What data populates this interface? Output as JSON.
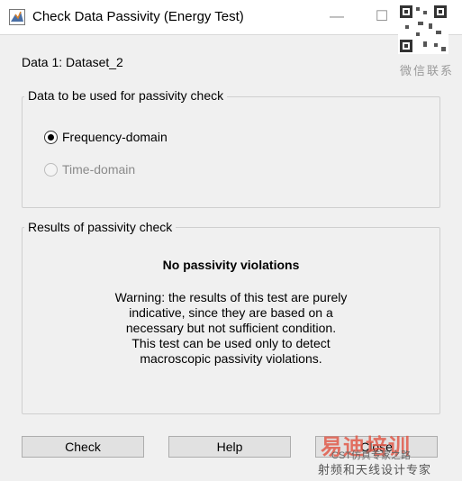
{
  "window": {
    "title": "Check Data Passivity (Energy Test)",
    "minimize_glyph": "—",
    "maximize_glyph": "☐",
    "close_glyph": "✕",
    "icon": "matlab-icon"
  },
  "data_label": "Data 1: Dataset_2",
  "passivity_group": {
    "legend": "Data to be used for passivity check",
    "options": [
      {
        "label": "Frequency-domain",
        "selected": true,
        "enabled": true
      },
      {
        "label": "Time-domain",
        "selected": false,
        "enabled": false
      }
    ]
  },
  "results_group": {
    "legend": "Results of passivity check",
    "result_title": "No passivity violations",
    "warning_lines": [
      "Warning: the results of this test are purely",
      "indicative, since they are based on a",
      "necessary but not sufficient condition.",
      "This test can be used only to detect",
      "macroscopic passivity violations."
    ]
  },
  "buttons": {
    "check": "Check",
    "help": "Help",
    "close": "Close"
  },
  "watermark": {
    "qr_label": "微信联系",
    "brand": "易迪培训",
    "handle": "CST仿真专家之路",
    "tagline": "射频和天线设计专家"
  }
}
